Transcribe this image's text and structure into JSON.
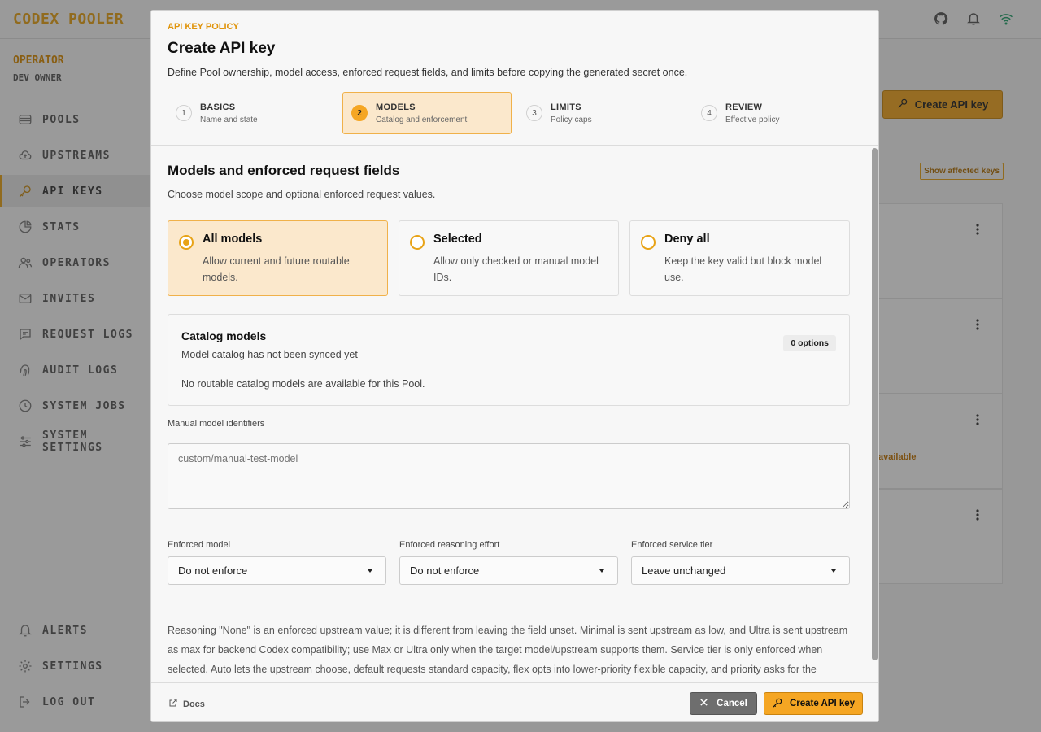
{
  "app": {
    "brand": "CODEX POOLER",
    "operator_label": "OPERATOR",
    "operator_name": "DEV OWNER",
    "nav": [
      {
        "label": "POOLS",
        "icon": "database-icon"
      },
      {
        "label": "UPSTREAMS",
        "icon": "cloud-upload-icon"
      },
      {
        "label": "API KEYS",
        "icon": "key-icon",
        "active": true
      },
      {
        "label": "STATS",
        "icon": "pie-chart-icon"
      },
      {
        "label": "OPERATORS",
        "icon": "users-icon"
      },
      {
        "label": "INVITES",
        "icon": "mail-icon"
      },
      {
        "label": "REQUEST LOGS",
        "icon": "message-icon"
      },
      {
        "label": "AUDIT LOGS",
        "icon": "fingerprint-icon"
      },
      {
        "label": "SYSTEM JOBS",
        "icon": "clock-icon"
      },
      {
        "label": "SYSTEM SETTINGS",
        "icon": "sliders-icon"
      }
    ],
    "nav_bottom": [
      {
        "label": "ALERTS",
        "icon": "bell-icon"
      },
      {
        "label": "SETTINGS",
        "icon": "gear-icon"
      },
      {
        "label": "LOG OUT",
        "icon": "logout-icon"
      }
    ],
    "page_create_button": "Create API key",
    "show_affected_keys": "Show affected keys",
    "bg_link_fragment": "available"
  },
  "modal": {
    "eyebrow": "API KEY POLICY",
    "title": "Create API key",
    "description": "Define Pool ownership, model access, enforced request fields, and limits before copying the generated secret once.",
    "steps": [
      {
        "num": "1",
        "title": "BASICS",
        "sub": "Name and state"
      },
      {
        "num": "2",
        "title": "MODELS",
        "sub": "Catalog and enforcement",
        "active": true
      },
      {
        "num": "3",
        "title": "LIMITS",
        "sub": "Policy caps"
      },
      {
        "num": "4",
        "title": "REVIEW",
        "sub": "Effective policy"
      }
    ],
    "section_title": "Models and enforced request fields",
    "section_desc": "Choose model scope and optional enforced request values.",
    "scope_options": [
      {
        "title": "All models",
        "desc": "Allow current and future routable models.",
        "selected": true
      },
      {
        "title": "Selected",
        "desc": "Allow only checked or manual model IDs."
      },
      {
        "title": "Deny all",
        "desc": "Keep the key valid but block model use."
      }
    ],
    "catalog": {
      "title": "Catalog models",
      "subtitle": "Model catalog has not been synced yet",
      "badge": "0 options",
      "empty": "No routable catalog models are available for this Pool."
    },
    "manual_label": "Manual model identifiers",
    "manual_placeholder": "custom/manual-test-model",
    "enforced": [
      {
        "label": "Enforced model",
        "value": "Do not enforce"
      },
      {
        "label": "Enforced reasoning effort",
        "value": "Do not enforce"
      },
      {
        "label": "Enforced service tier",
        "value": "Leave unchanged"
      }
    ],
    "note": "Reasoning \"None\" is an enforced upstream value; it is different from leaving the field unset. Minimal is sent upstream as low, and Ultra is sent upstream as max for backend Codex compatibility; use Max or Ultra only when the target model/upstream supports them. Service tier is only enforced when selected. Auto lets the upstream choose, default requests standard capacity, flex opts into lower-priority flexible capacity, and priority asks for the highest available tier.",
    "footer": {
      "docs": "Docs",
      "cancel": "Cancel",
      "create": "Create API key"
    }
  },
  "colors": {
    "accent": "#f5a623",
    "accent_dark": "#e8a317",
    "selected_bg": "#fbe8cc"
  }
}
